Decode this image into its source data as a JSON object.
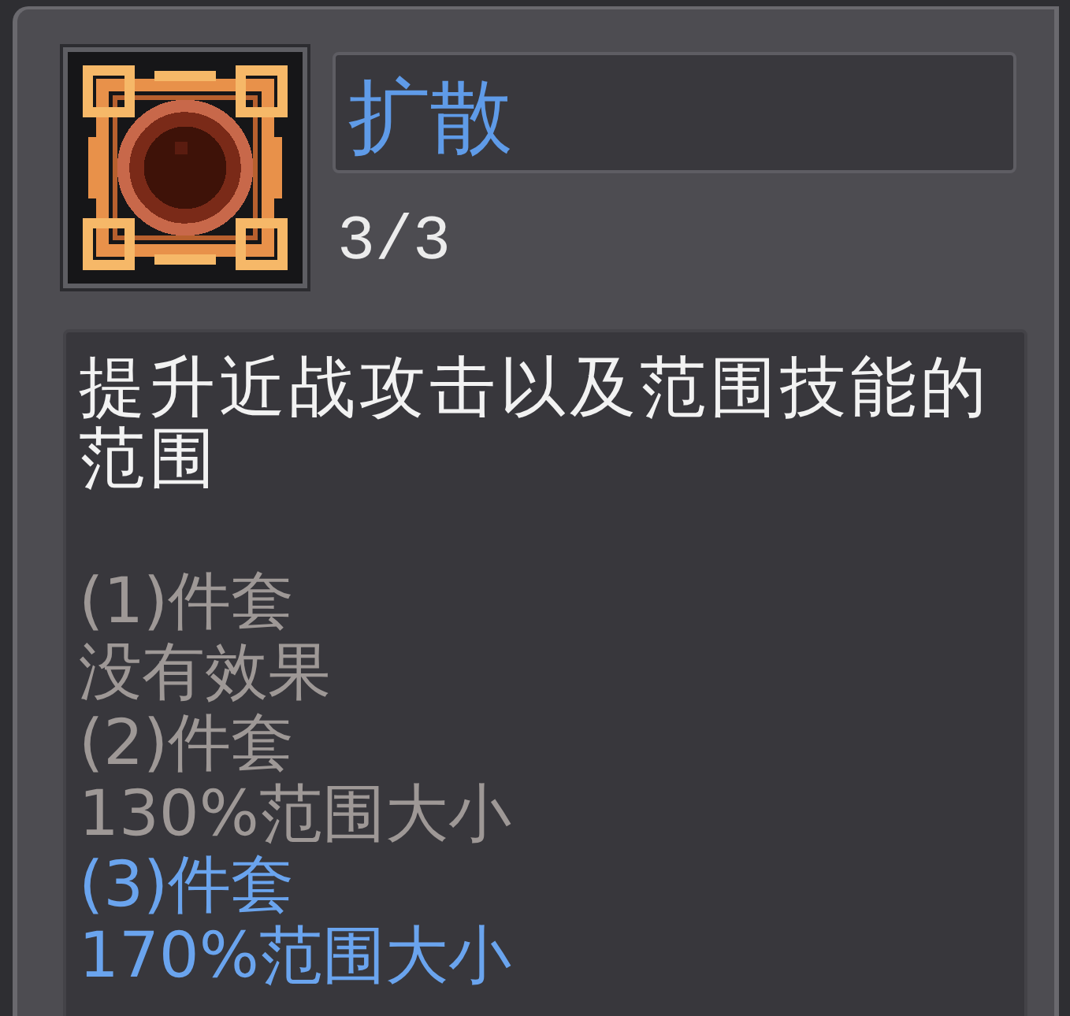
{
  "skill": {
    "name": "扩散",
    "rank": "3/3",
    "description": "提升近战攻击以及范围技能的范围"
  },
  "set_bonuses": [
    {
      "requirement": "(1)件套",
      "effect": "没有效果",
      "active": false
    },
    {
      "requirement": "(2)件套",
      "effect": "130%范围大小",
      "active": false
    },
    {
      "requirement": "(3)件套",
      "effect": "170%范围大小",
      "active": true
    }
  ]
}
